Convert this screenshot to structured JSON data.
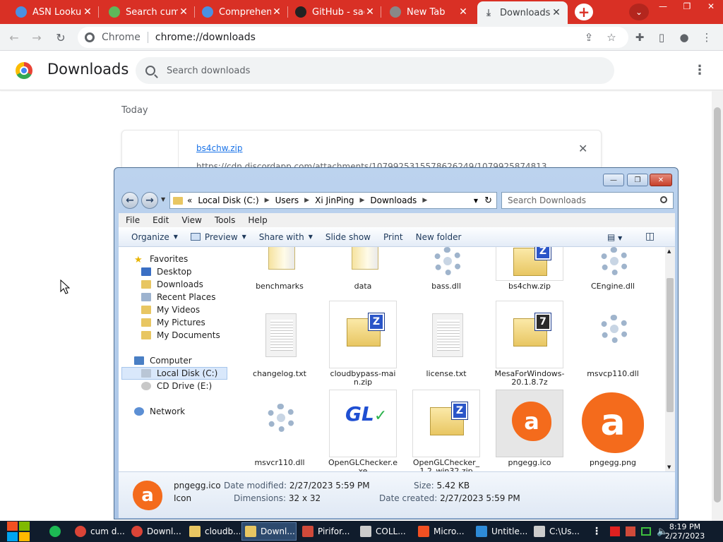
{
  "tabs": [
    {
      "label": "ASN Lookup",
      "icon": "shield-icon",
      "icon_color": "#4a90e2"
    },
    {
      "label": "Search cum",
      "icon": "shopify-icon",
      "icon_color": "#5fb85a"
    },
    {
      "label": "Comprehens",
      "icon": "shield-icon",
      "icon_color": "#4a90e2"
    },
    {
      "label": "GitHub - sad",
      "icon": "github-icon",
      "icon_color": "#222222"
    },
    {
      "label": "New Tab",
      "icon": "chrome-icon",
      "icon_color": "#888888"
    },
    {
      "label": "Downloads",
      "icon": "download-icon",
      "icon_color": "#5f6368"
    }
  ],
  "close_glyph": "✕",
  "newtab_glyph": "+",
  "tabsearch_glyph": "⌄",
  "window_controls": {
    "minimize": "—",
    "maximize": "❐",
    "close": "✕"
  },
  "omnibox": {
    "site": "Chrome",
    "url": "chrome://downloads"
  },
  "downloads": {
    "title": "Downloads",
    "search_placeholder": "Search downloads",
    "section": "Today",
    "item": {
      "filename": "bs4chw.zip",
      "url": "https://cdn.discordapp.com/attachments/1079925315578626249/1079925874813"
    }
  },
  "explorer": {
    "path": [
      "«",
      "Local Disk (C:)",
      "Users",
      "Xi JinPing",
      "Downloads"
    ],
    "search_placeholder": "Search Downloads",
    "menu": [
      "File",
      "Edit",
      "View",
      "Tools",
      "Help"
    ],
    "commands": {
      "organize": "Organize",
      "preview": "Preview",
      "share_with": "Share with",
      "slide_show": "Slide show",
      "print": "Print",
      "new_folder": "New folder"
    },
    "nav": {
      "favorites": "Favorites",
      "desktop": "Desktop",
      "downloads": "Downloads",
      "recent_places": "Recent Places",
      "my_videos": "My Videos",
      "my_pictures": "My Pictures",
      "my_documents": "My Documents",
      "computer": "Computer",
      "local_disk": "Local Disk (C:)",
      "cd_drive": "CD Drive (E:)",
      "network": "Network"
    },
    "files": [
      {
        "name": "benchmarks",
        "kind": "folder"
      },
      {
        "name": "data",
        "kind": "folder"
      },
      {
        "name": "bass.dll",
        "kind": "gear"
      },
      {
        "name": "bs4chw.zip",
        "kind": "zip"
      },
      {
        "name": "CEngine.dll",
        "kind": "gear"
      },
      {
        "name": "changelog.txt",
        "kind": "doc"
      },
      {
        "name": "cloudbypass-main.zip",
        "kind": "zip"
      },
      {
        "name": "license.txt",
        "kind": "doc"
      },
      {
        "name": "MesaForWindows-20.1.8.7z",
        "kind": "7z"
      },
      {
        "name": "msvcp110.dll",
        "kind": "gear"
      },
      {
        "name": "msvcr110.dll",
        "kind": "gear"
      },
      {
        "name": "OpenGLChecker.exe",
        "kind": "gl"
      },
      {
        "name": "OpenGLChecker_1.2_win32.zip",
        "kind": "zip"
      },
      {
        "name": "pngegg.ico",
        "kind": "avast"
      },
      {
        "name": "pngegg.png",
        "kind": "avast-big"
      }
    ],
    "details": {
      "name": "pngegg.ico",
      "type": "Icon",
      "date_modified_label": "Date modified:",
      "date_modified": "2/27/2023 5:59 PM",
      "dimensions_label": "Dimensions:",
      "dimensions": "32 x 32",
      "size_label": "Size:",
      "size": "5.42 KB",
      "date_created_label": "Date created:",
      "date_created": "2/27/2023 5:59 PM"
    }
  },
  "taskbar": {
    "apps": [
      {
        "label": "",
        "icon": "spotify-icon",
        "icon_color": "#1db954"
      },
      {
        "label": "cum d...",
        "icon": "chrome-icon",
        "icon_color": "#db4437"
      },
      {
        "label": "Downl...",
        "icon": "chrome-icon",
        "icon_color": "#db4437"
      },
      {
        "label": "cloudb...",
        "icon": "folder-icon",
        "icon_color": "#e8c662"
      },
      {
        "label": "Downl...",
        "icon": "folder-icon",
        "icon_color": "#e8c662"
      },
      {
        "label": "Pirifor...",
        "icon": "piriform-icon",
        "icon_color": "#d04a3a"
      },
      {
        "label": "COLL...",
        "icon": "terminal-icon",
        "icon_color": "#cccccc"
      },
      {
        "label": "Micro...",
        "icon": "microsoft-icon",
        "icon_color": "#f25022"
      },
      {
        "label": "Untitle...",
        "icon": "vscode-icon",
        "icon_color": "#2e8bd8"
      },
      {
        "label": "C:\\Us...",
        "icon": "cmd-icon",
        "icon_color": "#cccccc"
      }
    ],
    "time": "8:19 PM",
    "date": "2/27/2023"
  }
}
